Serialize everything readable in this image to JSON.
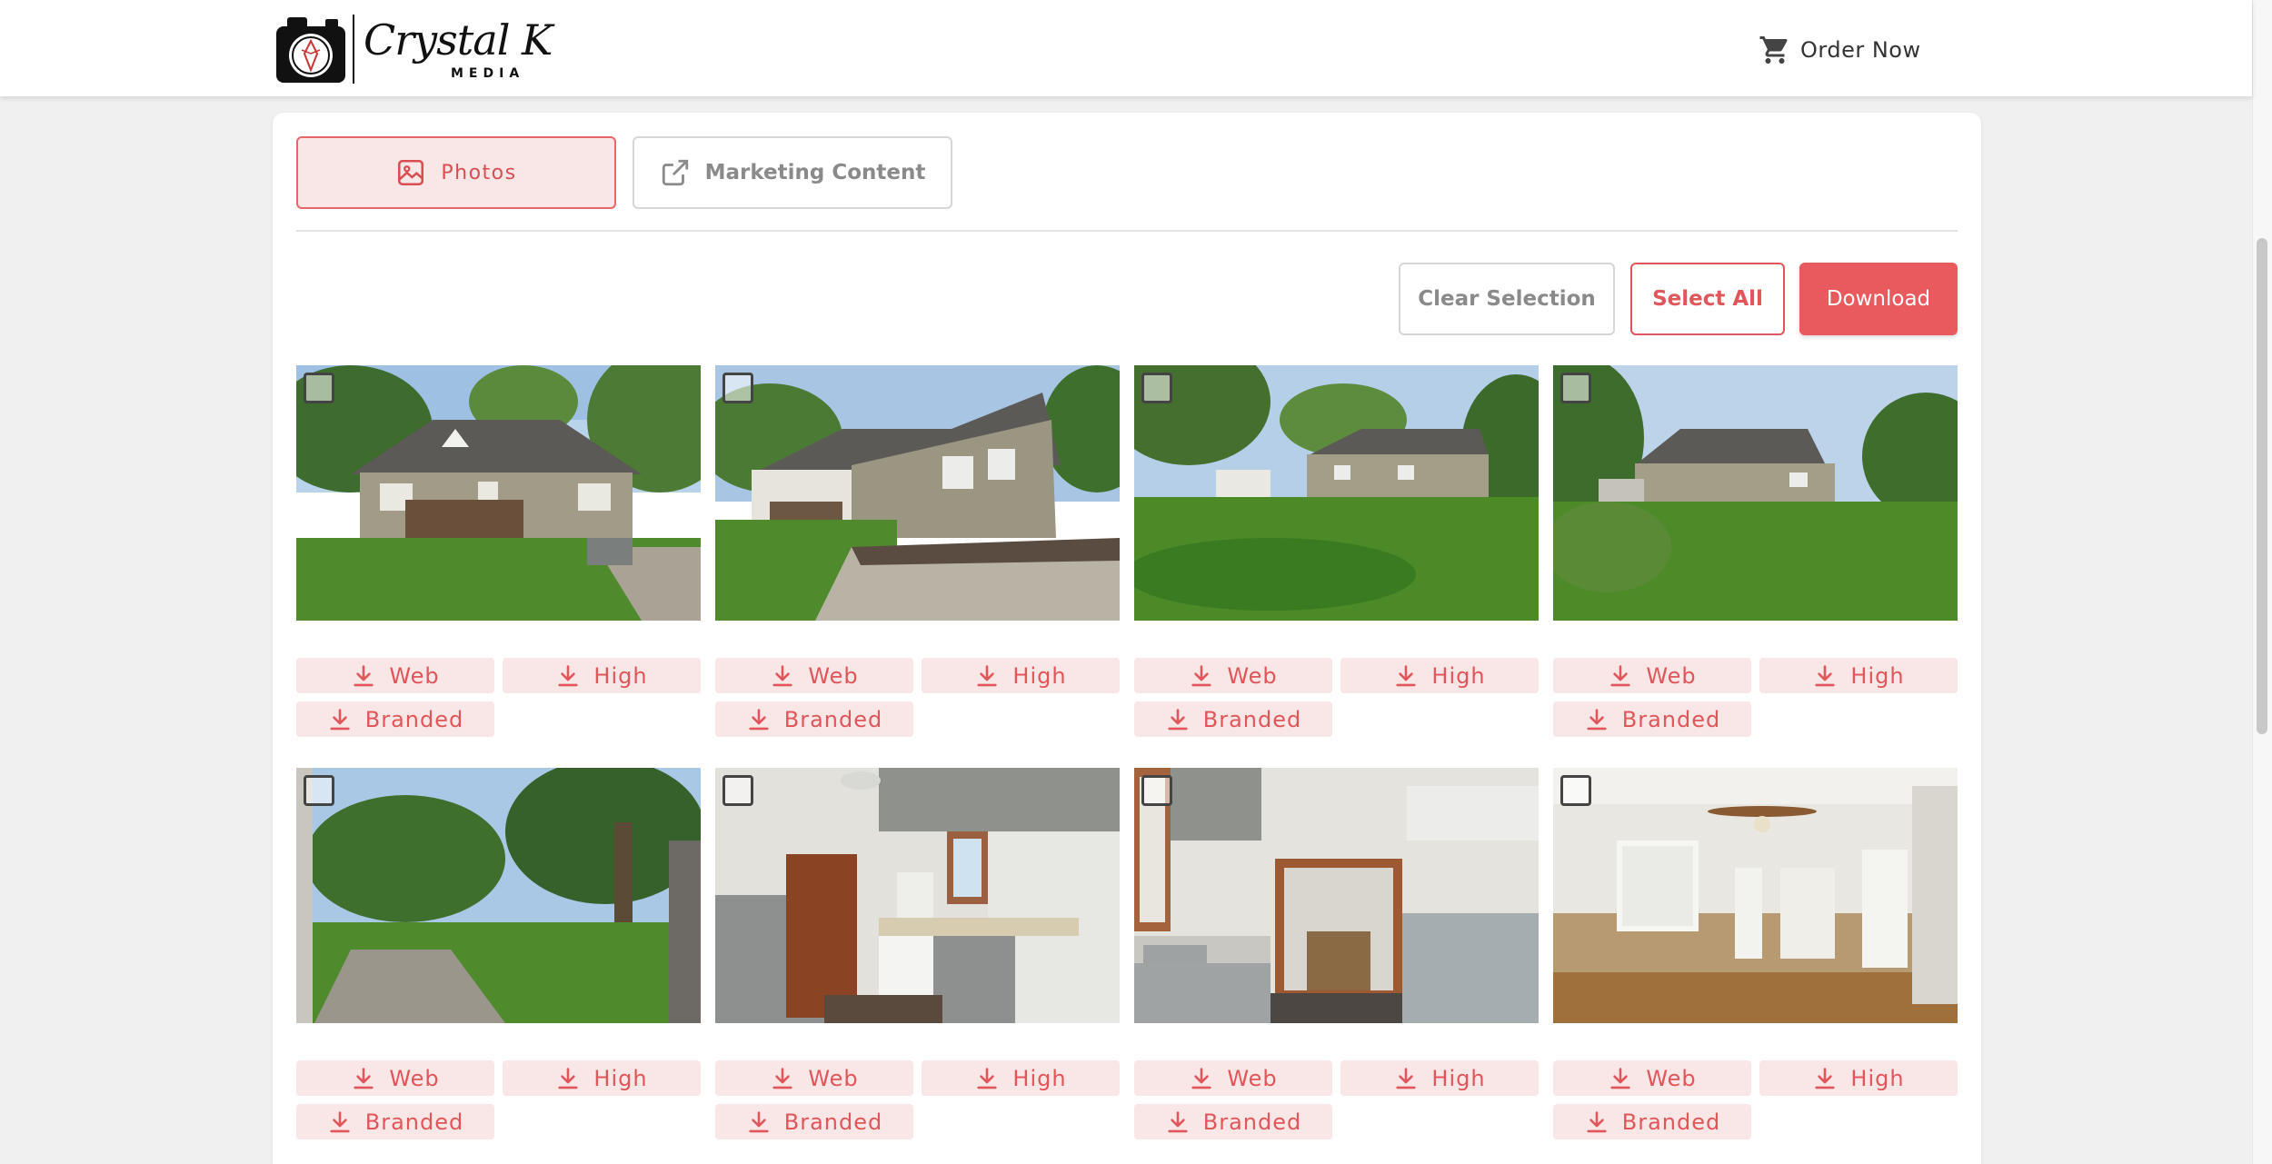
{
  "header": {
    "brand_script": "Crystal K",
    "brand_sub": "MEDIA",
    "order_now": "Order Now"
  },
  "tabs": [
    {
      "label": "Photos",
      "active": true,
      "icon": "image-icon"
    },
    {
      "label": "Marketing Content",
      "active": false,
      "icon": "external-link-icon"
    }
  ],
  "actions": {
    "clear_selection": "Clear Selection",
    "select_all": "Select All",
    "download": "Download"
  },
  "photos": [
    {
      "subject": "front exterior of tan ranch house with deck",
      "downloads": [
        "Web",
        "High",
        "Branded"
      ]
    },
    {
      "subject": "side exterior with steps and driveway",
      "downloads": [
        "Web",
        "High",
        "Branded"
      ]
    },
    {
      "subject": "rear yard and house",
      "downloads": [
        "Web",
        "High",
        "Branded"
      ]
    },
    {
      "subject": "back yard with shed",
      "downloads": [
        "Web",
        "High",
        "Branded"
      ]
    },
    {
      "subject": "wooded back yard with patio stones",
      "downloads": [
        "Web",
        "High",
        "Branded"
      ]
    },
    {
      "subject": "kitchen with wood door and white stove",
      "downloads": [
        "Web",
        "High",
        "Branded"
      ]
    },
    {
      "subject": "kitchen sink looking into dining room",
      "downloads": [
        "Web",
        "High",
        "Branded"
      ]
    },
    {
      "subject": "living room with ceiling fan and laminate floor",
      "downloads": [
        "Web",
        "High",
        "Branded"
      ]
    }
  ],
  "download_labels": {
    "web": "Web",
    "high": "High",
    "branded": "Branded"
  },
  "colors": {
    "accent": "#e95a5e",
    "accent_light": "#f9e6e6",
    "border_grey": "#d6d6d6"
  }
}
